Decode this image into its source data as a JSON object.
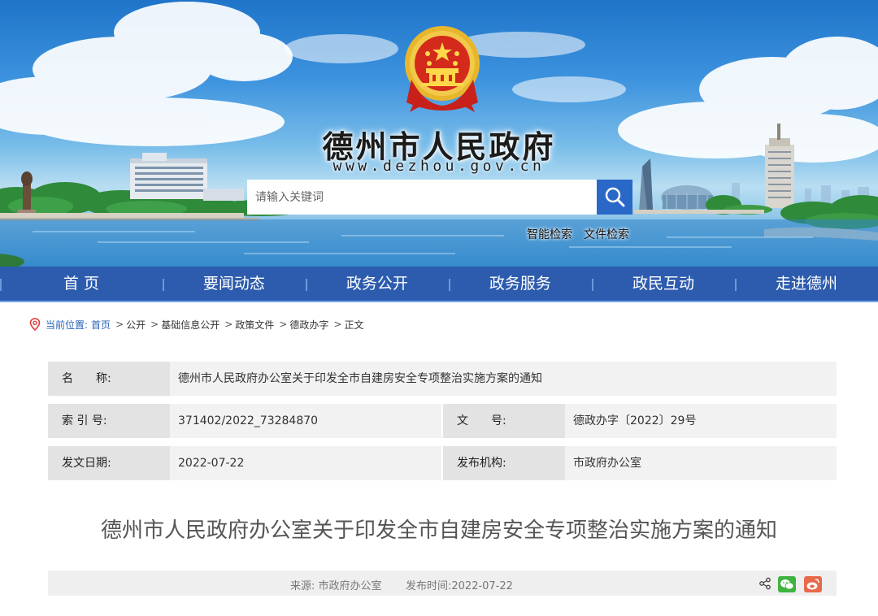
{
  "header": {
    "site_title": "德州市人民政府",
    "site_url": "www.dezhou.gov.cn",
    "search_placeholder": "请输入关键词",
    "smart_search": "智能检索",
    "file_search": "文件检索"
  },
  "nav": {
    "items": [
      "首 页",
      "要闻动态",
      "政务公开",
      "政务服务",
      "政民互动",
      "走进德州"
    ]
  },
  "breadcrumb": {
    "label": "当前位置:",
    "items": [
      "首页",
      "公开",
      "基础信息公开",
      "政策文件",
      "德政办字",
      "正文"
    ]
  },
  "info": {
    "name_label": "名　　称:",
    "name_value": "德州市人民政府办公室关于印发全市自建房安全专项整治实施方案的通知",
    "index_label": "索 引 号:",
    "index_value": "371402/2022_73284870",
    "docno_label": "文　　号:",
    "docno_value": "德政办字〔2022〕29号",
    "date_label": "发文日期:",
    "date_value": "2022-07-22",
    "org_label": "发布机构:",
    "org_value": "市政府办公室"
  },
  "article": {
    "title": "德州市人民政府办公室关于印发全市自建房安全专项整治实施方案的通知",
    "source": "来源: 市政府办公室",
    "publish_time": "发布时间:2022-07-22"
  },
  "colors": {
    "nav_bg": "#2d5cae",
    "search_button": "#2a68c8",
    "wechat": "#3fb33f",
    "weibo": "#e86a4b"
  },
  "icons": [
    "national-emblem-icon",
    "search-icon",
    "location-pin-icon",
    "share-icon",
    "wechat-icon",
    "weibo-icon"
  ]
}
